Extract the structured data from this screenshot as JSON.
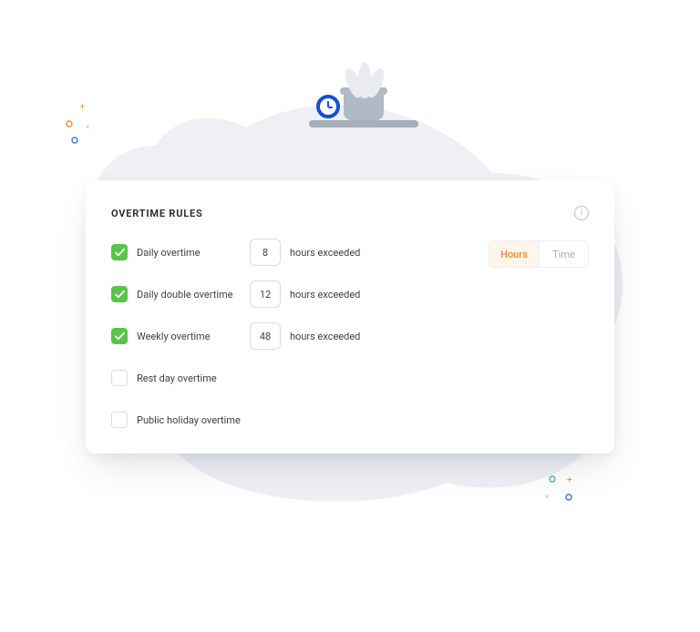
{
  "card": {
    "title": "OVERTIME RULES",
    "info_tooltip": "i"
  },
  "toggle": {
    "hours": "Hours",
    "time": "Time",
    "active": "hours"
  },
  "rules": [
    {
      "label": "Daily overtime",
      "checked": true,
      "value": "8",
      "trail": "hours exceeded"
    },
    {
      "label": "Daily double overtime",
      "checked": true,
      "value": "12",
      "trail": "hours exceeded"
    },
    {
      "label": "Weekly overtime",
      "checked": true,
      "value": "48",
      "trail": "hours exceeded"
    },
    {
      "label": "Rest day overtime",
      "checked": false
    },
    {
      "label": "Public holiday overtime",
      "checked": false
    }
  ]
}
